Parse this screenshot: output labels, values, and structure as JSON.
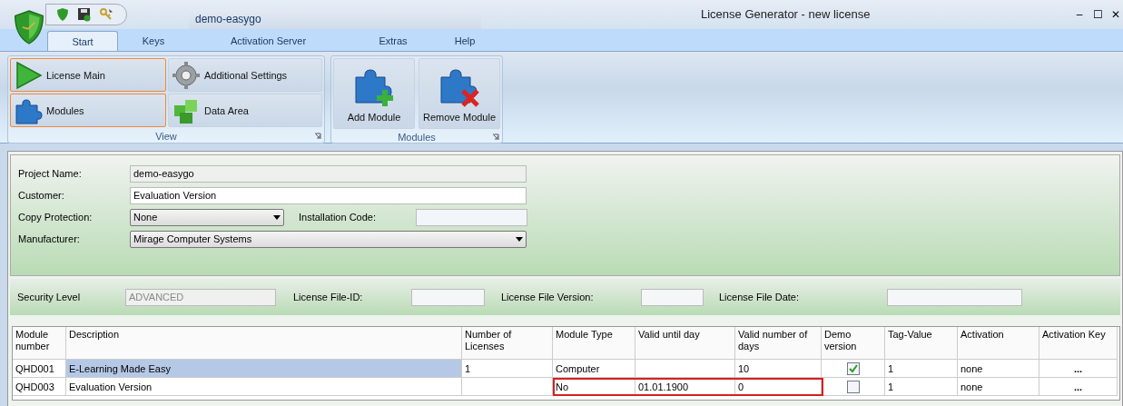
{
  "window": {
    "title": "License Generator - new license",
    "document_tab": "demo-easygo",
    "controls": [
      "–",
      "☐",
      "✕"
    ]
  },
  "tabs": [
    {
      "label": "Start",
      "selected": true
    },
    {
      "label": "Keys",
      "selected": false
    },
    {
      "label": "Activation Server",
      "selected": false
    },
    {
      "label": "Extras",
      "selected": false
    },
    {
      "label": "Help",
      "selected": false
    }
  ],
  "ribbon": {
    "groups": [
      {
        "caption": "View",
        "kind": "grid",
        "buttons": [
          {
            "label": "License Main",
            "selected": true
          },
          {
            "label": "Additional Settings",
            "selected": false
          },
          {
            "label": "Modules",
            "selected": true
          },
          {
            "label": "Data Area",
            "selected": false
          }
        ]
      },
      {
        "caption": "Modules",
        "kind": "large",
        "buttons": [
          {
            "label": "Add Module",
            "selected": false
          },
          {
            "label": "Remove Module",
            "selected": false
          }
        ]
      }
    ]
  },
  "form": {
    "fields": [
      {
        "label": "Project Name:",
        "value": "demo-easygo",
        "kind": "readonly"
      },
      {
        "label": "Customer:",
        "value": "Evaluation Version",
        "kind": "text"
      },
      {
        "label": "Copy Protection:",
        "value": "None",
        "kind": "select",
        "extra_label": "Installation Code:"
      },
      {
        "label": "Manufacturer:",
        "value": "Mirage Computer Systems",
        "kind": "select"
      }
    ]
  },
  "security": {
    "items": [
      {
        "label": "Security Level",
        "value": "ADVANCED",
        "disabled": true
      },
      {
        "label": "License File-ID:"
      },
      {
        "label": "License File Version:"
      },
      {
        "label": "License File Date:"
      }
    ]
  },
  "table": {
    "columns": [
      "Module number",
      "Description",
      "Number of Licenses",
      "Module Type",
      "Valid until day",
      "Valid number of days",
      "Demo version",
      "Tag-Value",
      "Activation",
      "Activation Key"
    ],
    "rows": [
      {
        "selected": true,
        "outlined": false,
        "module_number": "QHD001",
        "description": "E-Learning Made Easy",
        "licenses": "1",
        "module_type": "Computer",
        "valid_until": "",
        "valid_days": "10",
        "demo": true,
        "tag_value": "1",
        "activation": "none",
        "activation_key": "..."
      },
      {
        "selected": false,
        "outlined": true,
        "module_number": "QHD003",
        "description": "Evaluation Version",
        "licenses": "",
        "module_type": "No",
        "valid_until": "01.01.1900",
        "valid_days": "0",
        "demo": false,
        "tag_value": "1",
        "activation": "none",
        "activation_key": "..."
      }
    ]
  }
}
